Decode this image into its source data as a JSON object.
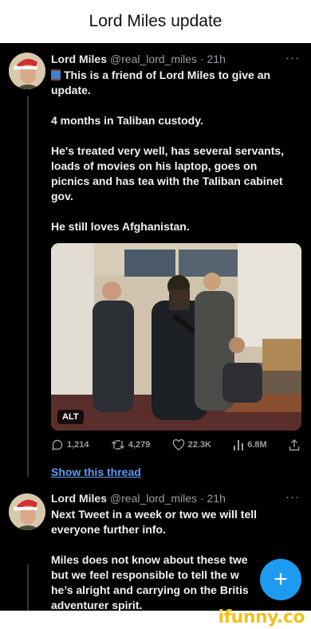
{
  "page_title": "Lord Miles update",
  "tweets": [
    {
      "name": "Lord Miles",
      "handle": "@real_lord_miles",
      "time": "· 21h",
      "more": "···",
      "emoji": "spool-of-thread",
      "lines": [
        "This is a friend of Lord Miles to give an update.",
        "4 months in Taliban custody.",
        "He's treated very well, has  several servants, loads of movies on his laptop, goes on picnics and has tea with the Taliban cabinet gov.",
        "He still loves Afghanistan."
      ],
      "media_alt_badge": "ALT",
      "stats": {
        "replies": "1,214",
        "retweets": "4,279",
        "likes": "22.3K",
        "views": "6.8M"
      }
    },
    {
      "name": "Lord Miles",
      "handle": "@real_lord_miles",
      "time": "· 21h",
      "more": "···",
      "lines": [
        "Next Tweet in a week or two we will tell everyone further info.",
        "Miles does not know about these twe",
        "but we feel responsible to tell the w",
        "he’s alright and carrying on the Britis",
        "adventurer spirit."
      ]
    }
  ],
  "show_thread": "Show this thread",
  "compose_button": "+",
  "watermark": "ifunny.co",
  "colors": {
    "feed_background": "#000000",
    "link": "#5b9bf0",
    "fab": "#1d9bf0",
    "watermark": "#f2c21b"
  }
}
